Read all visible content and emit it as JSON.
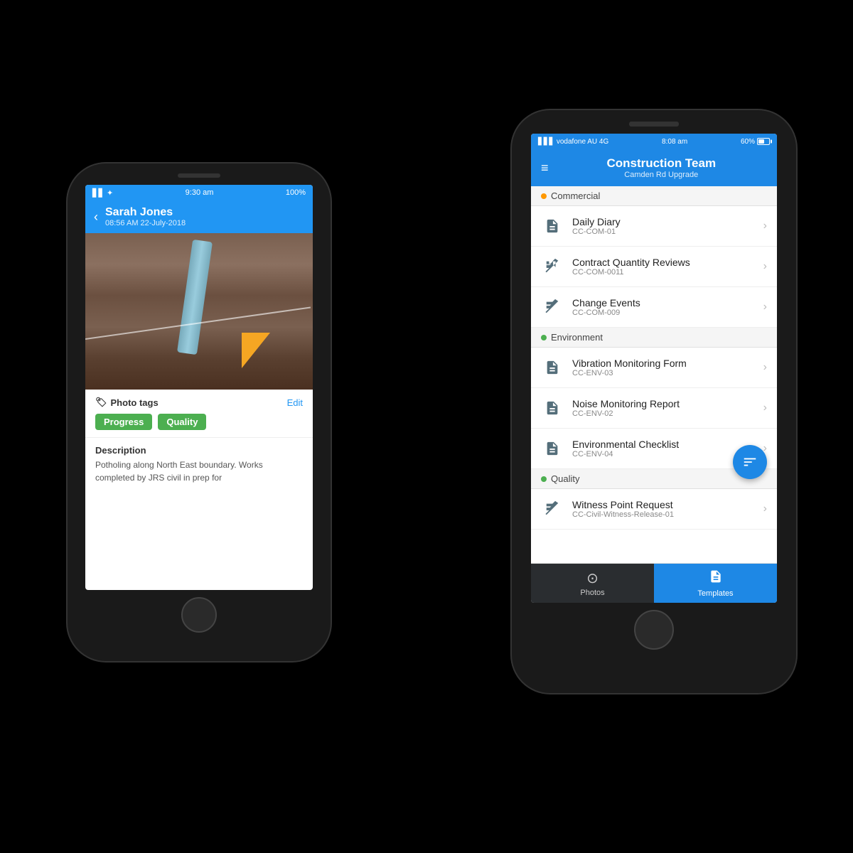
{
  "left_phone": {
    "status_bar": {
      "signal": "signal",
      "wifi": "wifi",
      "time": "9:30 am",
      "battery": "100%"
    },
    "header": {
      "back_label": "‹",
      "name": "Sarah Jones",
      "timestamp": "08:56 AM 22-July-2018"
    },
    "photo_tags": {
      "section_label": "Photo tags",
      "edit_label": "Edit",
      "tags": [
        "Progress",
        "Quality"
      ]
    },
    "description": {
      "label": "Description",
      "text": "Potholing along North East boundary. Works completed by JRS civil in prep for"
    }
  },
  "right_phone": {
    "status_bar": {
      "carrier": "vodafone AU",
      "network": "4G",
      "time": "8:08 am",
      "battery_pct": "60%"
    },
    "header": {
      "menu_icon": "≡",
      "title": "Construction Team",
      "subtitle": "Camden Rd Upgrade"
    },
    "sections": [
      {
        "name": "Commercial",
        "dot_color": "orange",
        "items": [
          {
            "icon": "doc",
            "title": "Daily Diary",
            "code": "CC-COM-01"
          },
          {
            "icon": "cross",
            "title": "Contract Quantity Reviews",
            "code": "CC-COM-0011"
          },
          {
            "icon": "cross",
            "title": "Change Events",
            "code": "CC-COM-009"
          }
        ]
      },
      {
        "name": "Environment",
        "dot_color": "green",
        "items": [
          {
            "icon": "doc",
            "title": "Vibration Monitoring Form",
            "code": "CC-ENV-03"
          },
          {
            "icon": "doc",
            "title": "Noise Monitoring Report",
            "code": "CC-ENV-02"
          },
          {
            "icon": "doc",
            "title": "Environmental Checklist",
            "code": "CC-ENV-04"
          }
        ]
      },
      {
        "name": "Quality",
        "dot_color": "green",
        "items": [
          {
            "icon": "cross",
            "title": "Witness Point Request",
            "code": "CC-Civil-Witness-Release-01"
          }
        ]
      }
    ],
    "tab_bar": {
      "tabs": [
        {
          "label": "Photos",
          "icon": "camera",
          "active": false
        },
        {
          "label": "Templates",
          "icon": "doc",
          "active": true
        }
      ]
    },
    "fab": {
      "icon": "filter"
    }
  }
}
